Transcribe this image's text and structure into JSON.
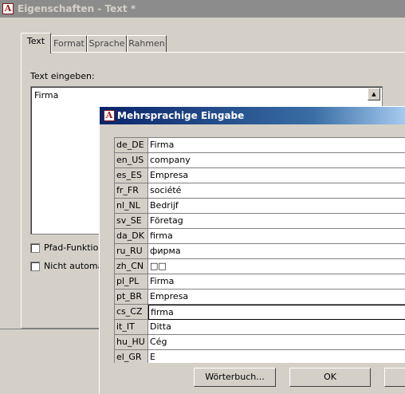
{
  "back_window": {
    "title": "Eigenschaften - Text *",
    "tabs": [
      {
        "label": "Text"
      },
      {
        "label": "Format"
      },
      {
        "label": "Sprache"
      },
      {
        "label": "Rahmen"
      }
    ],
    "text_label": "Text eingeben:",
    "text_value": "Firma",
    "checkbox_1": "Pfad-Funktions",
    "checkbox_2": "Nicht automati"
  },
  "dialog": {
    "title": "Mehrsprachige Eingabe",
    "rows": [
      {
        "code": "de_DE",
        "value": "Firma"
      },
      {
        "code": "en_US",
        "value": "company"
      },
      {
        "code": "es_ES",
        "value": "Empresa"
      },
      {
        "code": "fr_FR",
        "value": "société"
      },
      {
        "code": "nl_NL",
        "value": "Bedrijf"
      },
      {
        "code": "sv_SE",
        "value": "Företag"
      },
      {
        "code": "da_DK",
        "value": "firma"
      },
      {
        "code": "ru_RU",
        "value": "фирма"
      },
      {
        "code": "zh_CN",
        "value": "□□"
      },
      {
        "code": "pl_PL",
        "value": "Firma"
      },
      {
        "code": "pt_BR",
        "value": "Empresa"
      },
      {
        "code": "cs_CZ",
        "value": "firma"
      },
      {
        "code": "it_IT",
        "value": "Ditta"
      },
      {
        "code": "hu_HU",
        "value": "Cég"
      },
      {
        "code": "el_GR",
        "value": "Ε"
      }
    ],
    "dictionary_button": "Wörterbuch...",
    "ok_button": "OK"
  }
}
